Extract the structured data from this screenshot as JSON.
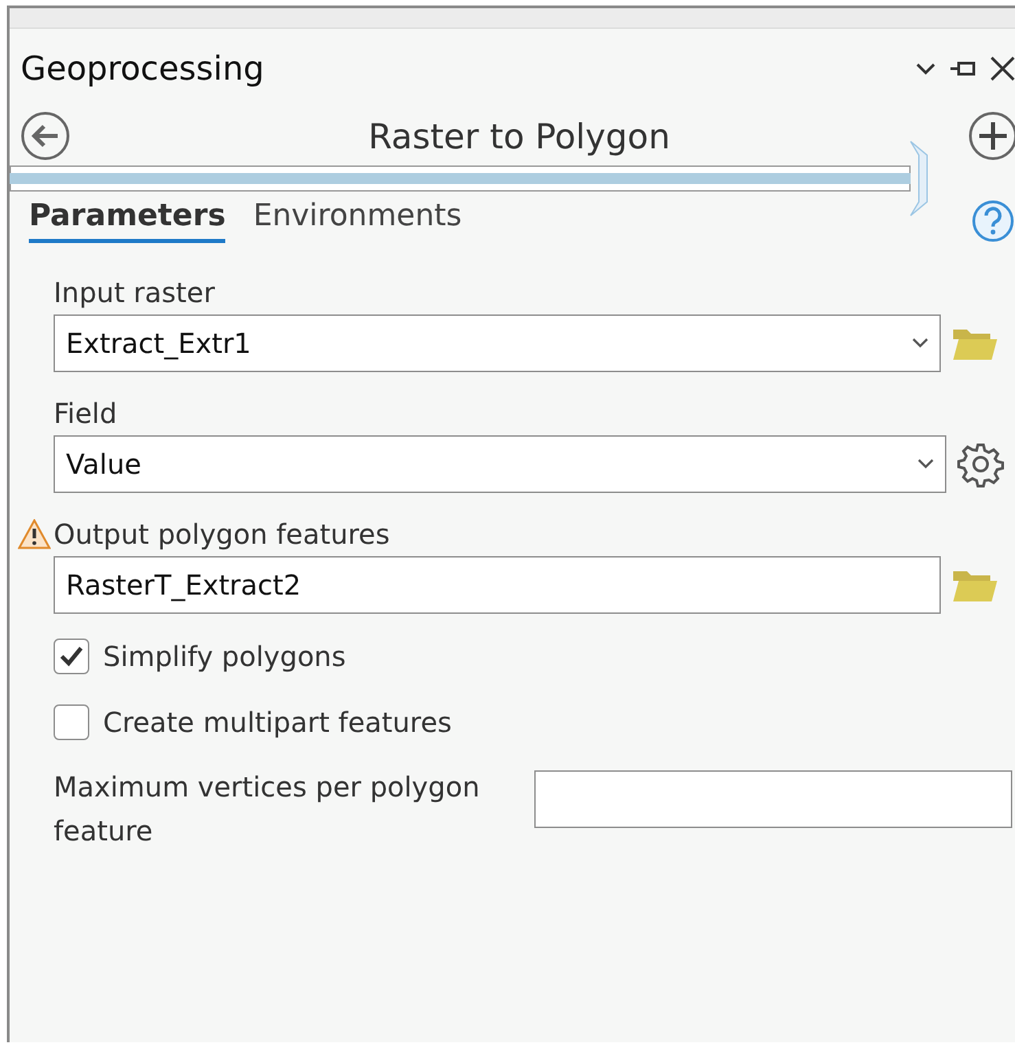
{
  "panel": {
    "title": "Geoprocessing"
  },
  "tool": {
    "title": "Raster to Polygon"
  },
  "tabs": [
    {
      "label": "Parameters",
      "selected": true
    },
    {
      "label": "Environments",
      "selected": false
    }
  ],
  "parameters": [
    {
      "kind": "dataset",
      "label": "Input raster",
      "value": "Extract_Extr1",
      "warning": false
    },
    {
      "kind": "field",
      "label": "Field",
      "value": "Value",
      "warning": false
    },
    {
      "kind": "output",
      "label": "Output polygon features",
      "value": "RasterT_Extract2",
      "warning": true
    },
    {
      "kind": "checkbox",
      "label": "Simplify polygons",
      "checked": true
    },
    {
      "kind": "checkbox",
      "label": "Create multipart features",
      "checked": false
    },
    {
      "kind": "inline",
      "label": "Maximum vertices per polygon feature"
    }
  ]
}
